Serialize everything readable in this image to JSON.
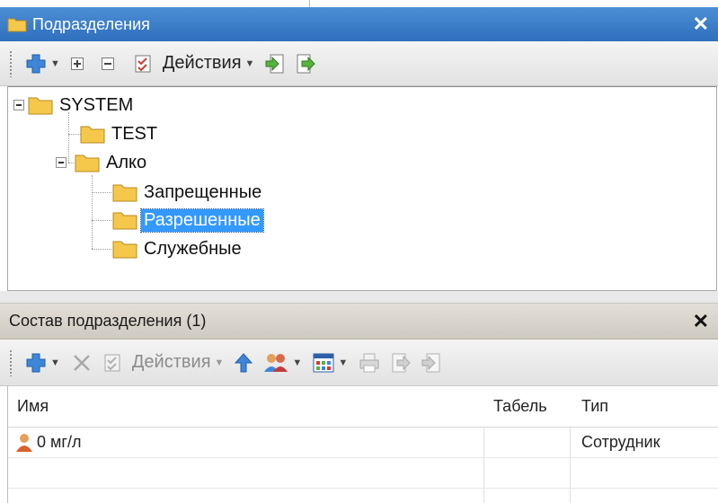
{
  "panel_top": {
    "title": "Подразделения",
    "close_glyph": "✕",
    "toolbar": {
      "add_icon": "plus-icon",
      "expand_icon": "expand-all-icon",
      "collapse_icon": "collapse-all-icon",
      "checklist_icon": "checklist-icon",
      "actions_label": "Действия",
      "import_icon": "import-icon",
      "export_icon": "export-icon"
    },
    "tree": {
      "root": "SYSTEM",
      "children": [
        {
          "label": "TEST"
        },
        {
          "label": "Алко",
          "children": [
            {
              "label": "Запрещенные"
            },
            {
              "label": "Разрешенные",
              "selected": true
            },
            {
              "label": "Служебные"
            }
          ]
        }
      ]
    }
  },
  "panel_bottom": {
    "title": "Состав подразделения (1)",
    "close_glyph": "✕",
    "toolbar": {
      "actions_label": "Действия",
      "icons": [
        "plus-icon",
        "delete-icon",
        "checklist-icon",
        "move-up-icon",
        "users-icon",
        "table-view-icon",
        "print-icon",
        "export-icon",
        "import-icon"
      ]
    },
    "grid": {
      "columns": [
        "Имя",
        "Табель",
        "Тип"
      ],
      "rows": [
        {
          "name": "0 мг/л",
          "tabel": "",
          "type": "Сотрудник"
        }
      ]
    }
  },
  "colors": {
    "title_bar": "#3f80cc",
    "selection": "#3399ff",
    "folder": "#f5c84c"
  }
}
